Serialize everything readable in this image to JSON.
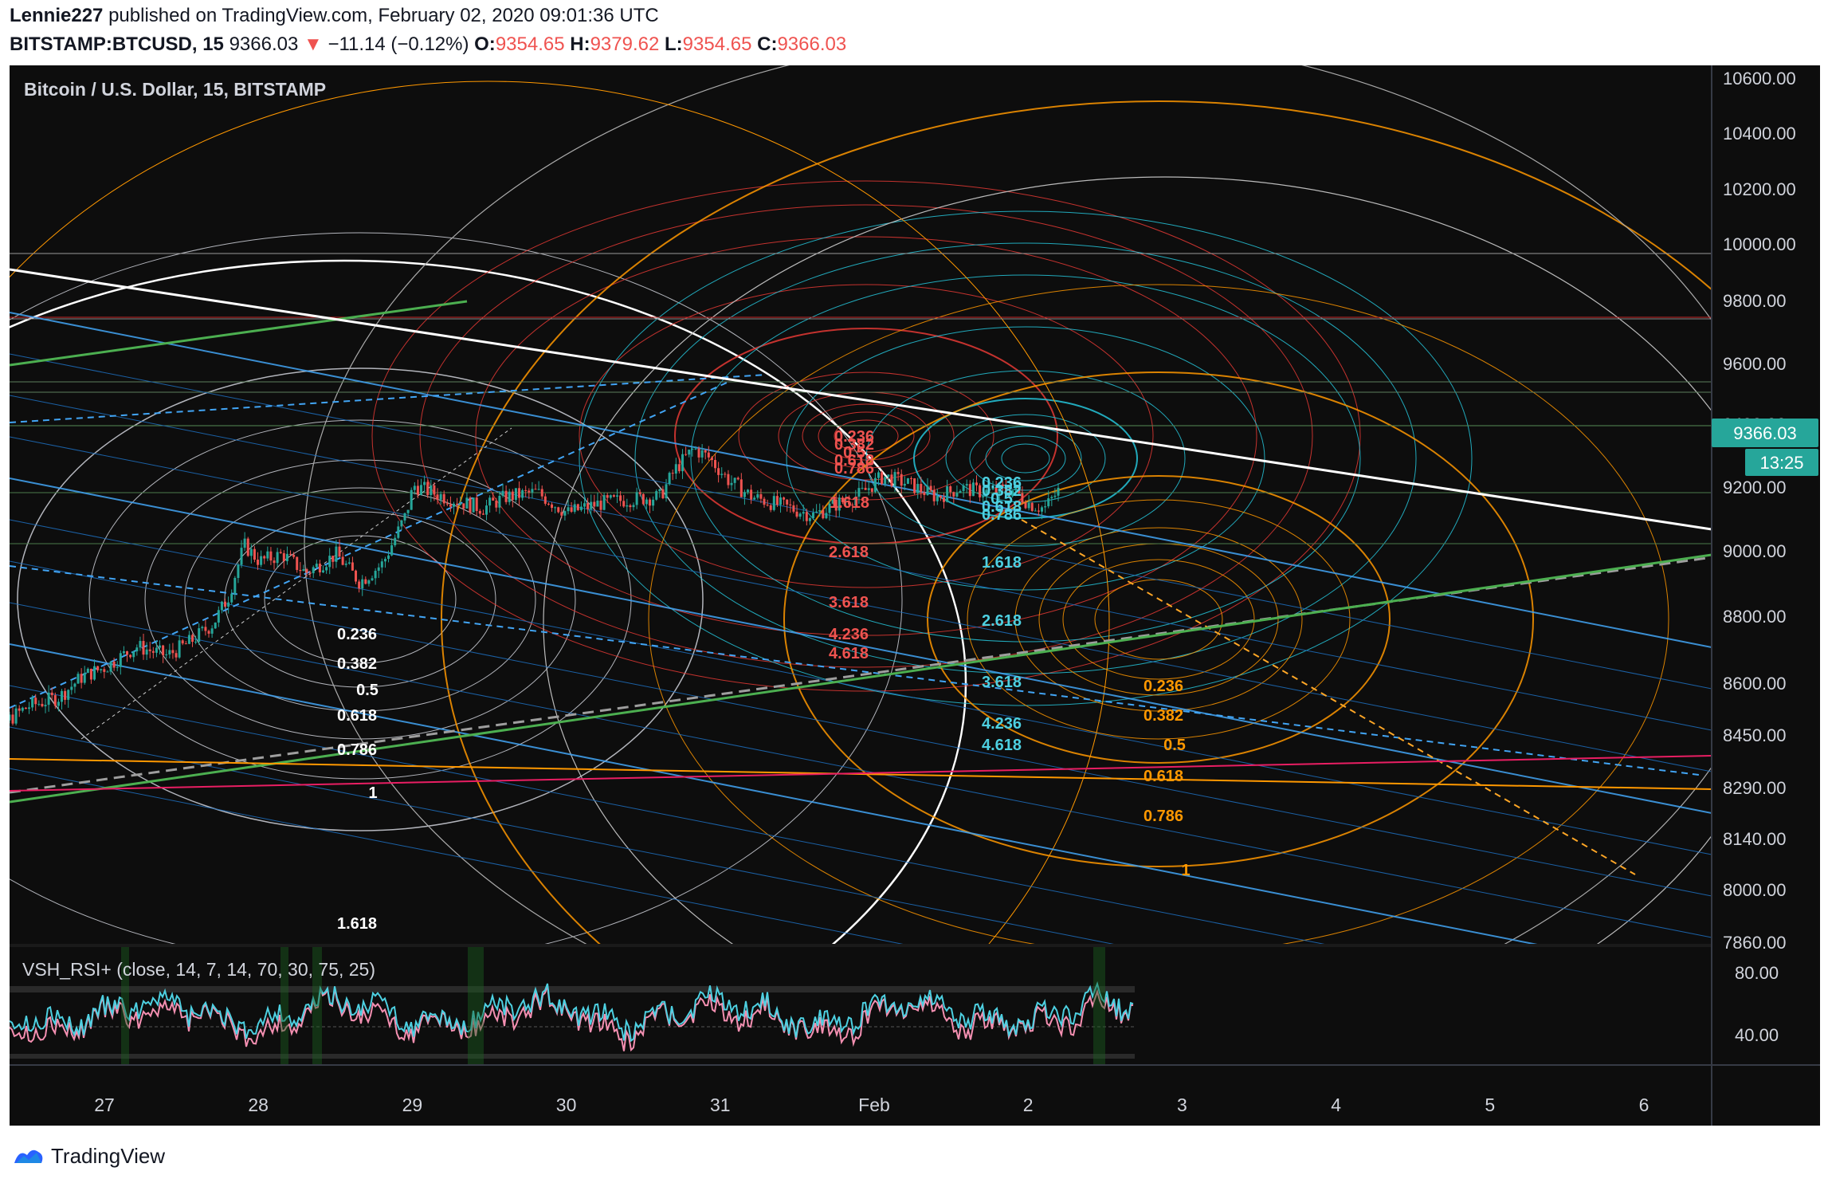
{
  "header": {
    "publisher": "Lennie227",
    "published_text": "published on TradingView.com, February 02, 2020 09:01:36 UTC",
    "symbol": "BITSTAMP:BTCUSD, 15",
    "last": "9366.03",
    "change_arrow": "▼",
    "change": "−11.14 (−0.12%)",
    "o_label": "O:",
    "o": "9354.65",
    "h_label": "H:",
    "h": "9379.62",
    "l_label": "L:",
    "l": "9354.65",
    "c_label": "C:",
    "c": "9366.03"
  },
  "colors": {
    "down": "#ef5350",
    "up": "#26a69a",
    "badge": "#26a69a"
  },
  "chart_data": {
    "type": "candlestick",
    "title": "Bitcoin / U.S. Dollar, 15, BITSTAMP",
    "price_axis": [
      "10600.00",
      "10400.00",
      "10200.00",
      "10000.00",
      "9800.00",
      "9600.00",
      "9400.00",
      "9200.00",
      "9000.00",
      "8800.00",
      "8600.00",
      "8450.00",
      "8290.00",
      "8140.00",
      "8000.00",
      "7860.00"
    ],
    "price_badge": "9366.03",
    "time_badge": "13:25",
    "time_axis": [
      "27",
      "28",
      "29",
      "30",
      "31",
      "Feb",
      "2",
      "3",
      "4",
      "5",
      "6"
    ],
    "close_path": [
      [
        26.1,
        8290
      ],
      [
        26.3,
        8330
      ],
      [
        26.5,
        8420
      ],
      [
        26.7,
        8460
      ],
      [
        26.85,
        8550
      ],
      [
        27.0,
        8590
      ],
      [
        27.2,
        8680
      ],
      [
        27.4,
        8640
      ],
      [
        27.55,
        8700
      ],
      [
        27.7,
        8780
      ],
      [
        27.8,
        8900
      ],
      [
        27.9,
        9120
      ],
      [
        28.0,
        9050
      ],
      [
        28.15,
        9080
      ],
      [
        28.3,
        9000
      ],
      [
        28.5,
        9080
      ],
      [
        28.65,
        8960
      ],
      [
        28.8,
        9040
      ],
      [
        28.95,
        9250
      ],
      [
        29.0,
        9380
      ],
      [
        29.2,
        9330
      ],
      [
        29.45,
        9280
      ],
      [
        29.6,
        9330
      ],
      [
        29.8,
        9350
      ],
      [
        30.0,
        9260
      ],
      [
        30.2,
        9300
      ],
      [
        30.4,
        9320
      ],
      [
        30.6,
        9330
      ],
      [
        30.7,
        9450
      ],
      [
        30.82,
        9540
      ],
      [
        30.92,
        9500
      ],
      [
        31.05,
        9400
      ],
      [
        31.2,
        9330
      ],
      [
        31.4,
        9290
      ],
      [
        31.6,
        9250
      ],
      [
        31.75,
        9300
      ],
      [
        31.9,
        9340
      ],
      [
        32.05,
        9420
      ],
      [
        32.2,
        9390
      ],
      [
        32.4,
        9330
      ],
      [
        32.55,
        9370
      ],
      [
        32.7,
        9350
      ],
      [
        32.9,
        9360
      ],
      [
        33.0,
        9300
      ],
      [
        33.1,
        9280
      ],
      [
        33.2,
        9366
      ]
    ],
    "fib_levels_white": [
      "0.236",
      "0.382",
      "0.5",
      "0.618",
      "0.786",
      "1",
      "1.618"
    ],
    "fib_levels_red": [
      "0.236",
      "0.382",
      "0.5",
      "0.618",
      "0.786",
      "1.618",
      "2.618",
      "3.618",
      "4.236",
      "4.618"
    ],
    "fib_levels_cyan": [
      "0.236",
      "0.382",
      "0.5",
      "0.618",
      "0.786",
      "1.618",
      "2.618",
      "3.618",
      "4.236",
      "4.618"
    ],
    "fib_levels_orange": [
      "0.236",
      "0.382",
      "0.5",
      "0.618",
      "0.786",
      "1"
    ]
  },
  "indicator": {
    "label": "VSH_RSI+ (close, 14, 7, 14, 70, 30, 75, 25)",
    "axis": [
      "80.00",
      "40.00"
    ]
  },
  "footer": {
    "brand": "TradingView"
  }
}
